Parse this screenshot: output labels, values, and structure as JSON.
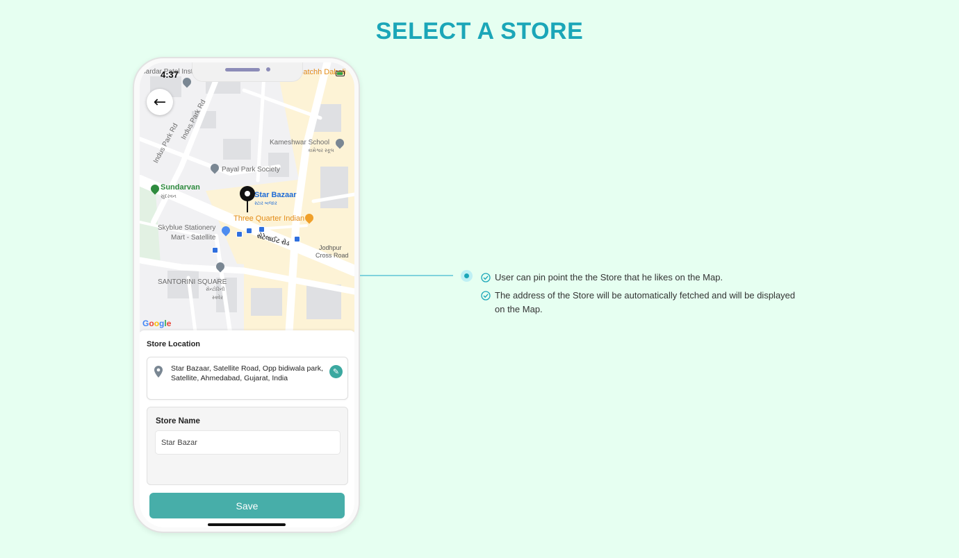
{
  "page": {
    "title": "SELECT A STORE"
  },
  "status_bar": {
    "time": "4:37"
  },
  "map": {
    "labels": {
      "top_left": "Sardar Patel Institute of Public...",
      "indus1": "Indus Park Rd",
      "indus2": "Indus Park Rd",
      "kameshwar": "Kameshwar School",
      "kameshwar_gu": "કામેશ્વર સ્કૂલ",
      "payal": "Payal Park Society",
      "sundarvan": "Sundarvan",
      "sundarvan_gu": "સુંદરવન",
      "store": "Star Bazaar",
      "store_gu": "સ્ટાર બજાર",
      "three_quarter": "Three Quarter Indian",
      "skyblue1": "Skyblue Stationery",
      "skyblue2": "Mart - Satellite",
      "satellite_road": "સેટેલાઈટ રોડ",
      "jodhpur1": "Jodhpur",
      "jodhpur2": "Cross Road",
      "santorini": "SANTORINI SQUARE",
      "santorini_gu1": "સેન્ટોરિની",
      "santorini_gu2": "સ્ક્વેર",
      "top_right": "Satchh Dabeli"
    },
    "google": "Google"
  },
  "sheet": {
    "heading": "Store  Location",
    "address": "Star Bazaar, Satellite Road, Opp bidiwala park, Satellite, Ahmedabad, Gujarat, India",
    "store_name_label": "Store Name",
    "store_name_value": "Star Bazar",
    "save_label": "Save"
  },
  "features": [
    "User can pin point the the Store that he likes on the Map.",
    "The address of the Store will be automatically fetched and will be displayed on the Map."
  ],
  "colors": {
    "accent": "#1ba6b8",
    "save_button": "#47aea9",
    "background": "#e6fff1"
  }
}
